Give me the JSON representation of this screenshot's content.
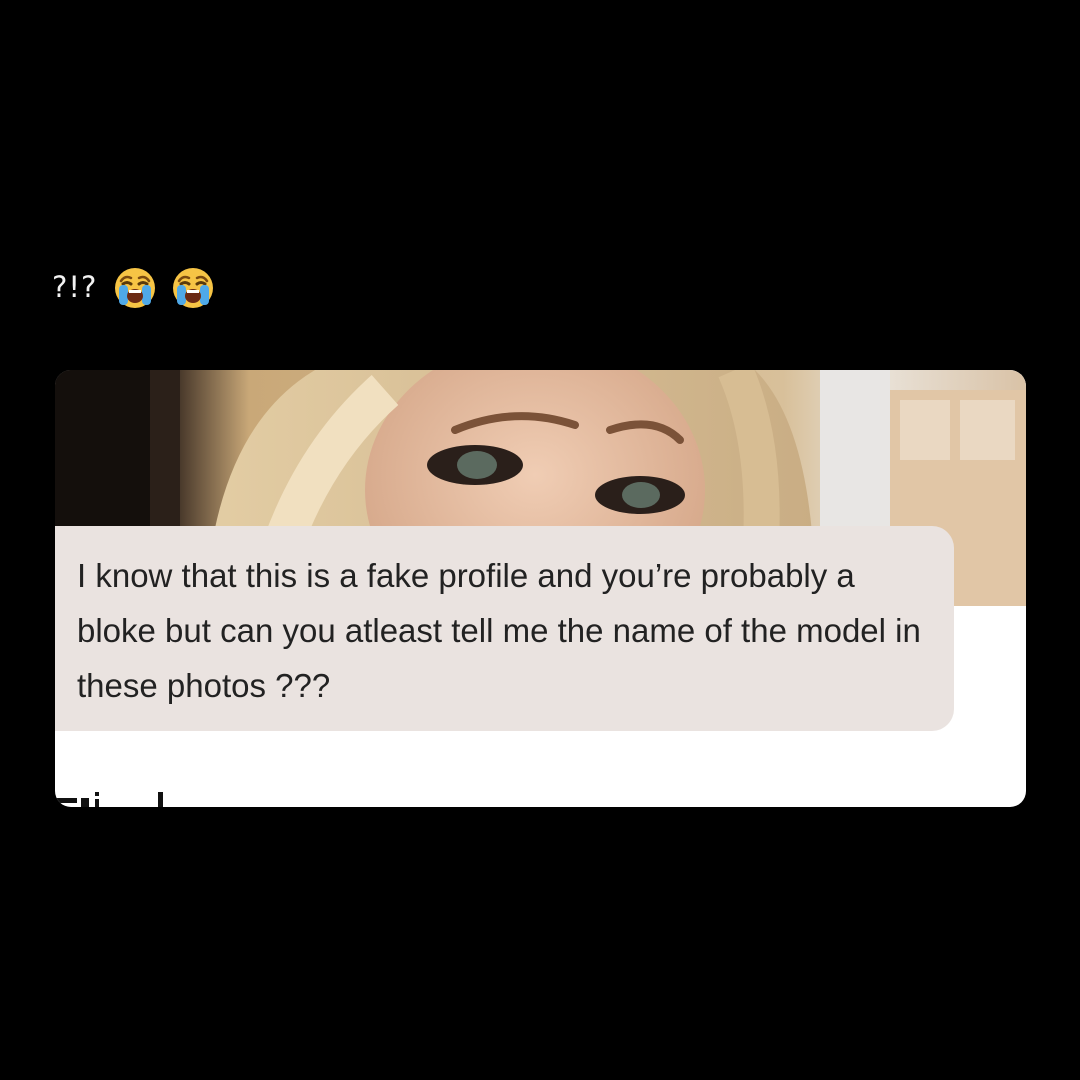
{
  "caption": {
    "text": "?!?",
    "emojis": [
      "loudly-crying-face-icon",
      "loudly-crying-face-icon"
    ]
  },
  "message": {
    "text": "I know that this is a fake profile and you’re probably a bloke but can you atleast tell me the name of the model in these photos ???"
  },
  "colors": {
    "background": "#000000",
    "card": "#ffffff",
    "bubble": "#eae3e0",
    "message_text": "#222222",
    "caption_text": "#f2f2f2"
  }
}
